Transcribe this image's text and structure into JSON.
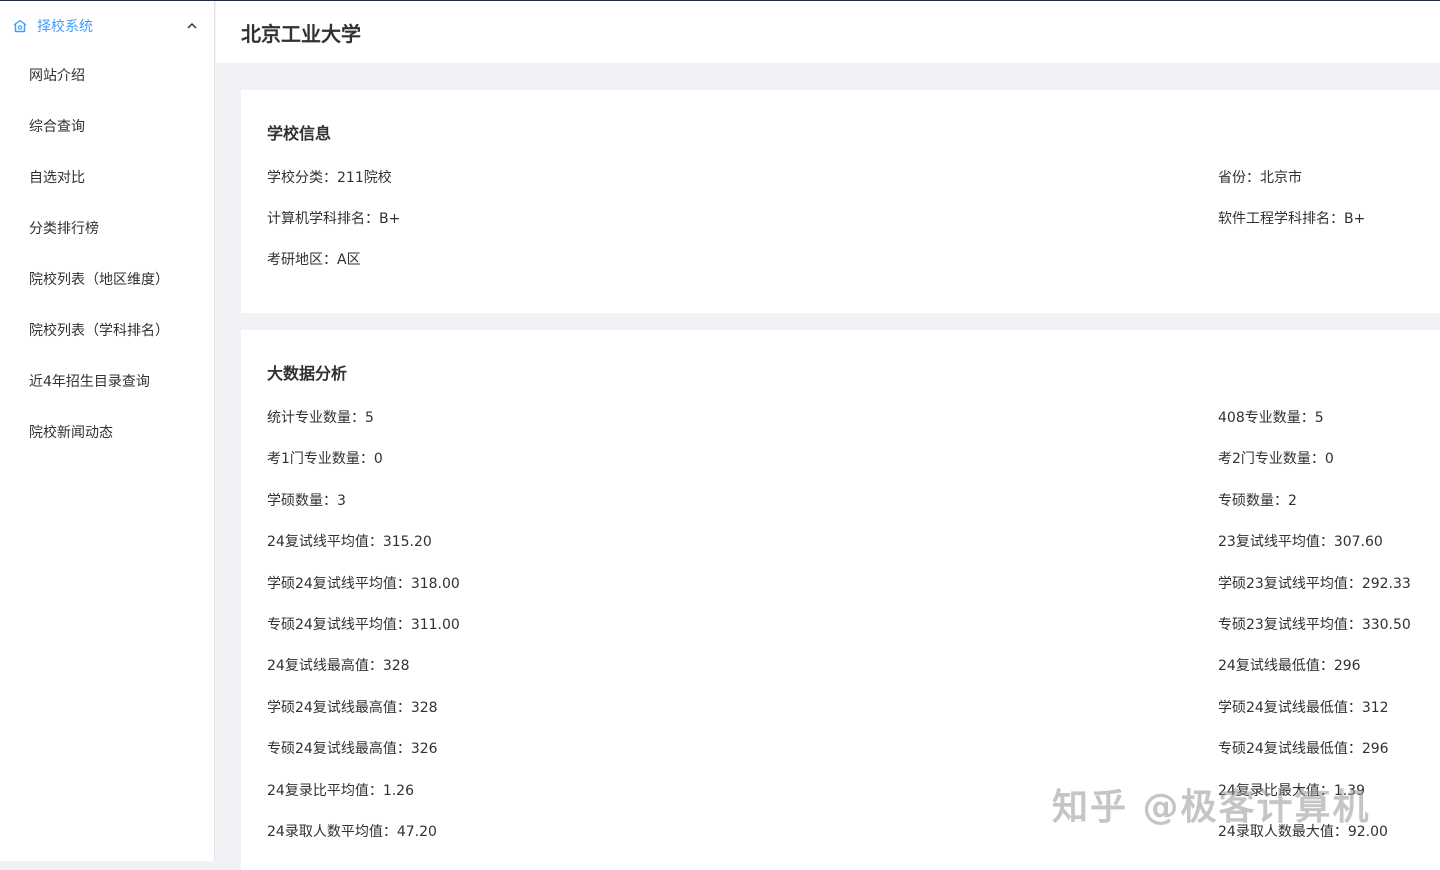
{
  "sidebar": {
    "menu_title": "择校系统",
    "items": [
      {
        "label": "网站介绍"
      },
      {
        "label": "综合查询"
      },
      {
        "label": "自选对比"
      },
      {
        "label": "分类排行榜"
      },
      {
        "label": "院校列表（地区维度）"
      },
      {
        "label": "院校列表（学科排名）"
      },
      {
        "label": "近4年招生目录查询"
      },
      {
        "label": "院校新闻动态"
      }
    ]
  },
  "header": {
    "title": "北京工业大学"
  },
  "school_info": {
    "heading": "学校信息",
    "rows": [
      {
        "left": "学校分类：211院校",
        "right": "省份：北京市"
      },
      {
        "left": "计算机学科排名：B+",
        "right": "软件工程学科排名：B+"
      },
      {
        "left": "考研地区：A区",
        "right": ""
      }
    ]
  },
  "analysis": {
    "heading": "大数据分析",
    "rows": [
      {
        "left": "统计专业数量：5",
        "right": "408专业数量：5"
      },
      {
        "left": "考1门专业数量：0",
        "right": "考2门专业数量：0"
      },
      {
        "left": "学硕数量：3",
        "right": "专硕数量：2"
      },
      {
        "left": "24复试线平均值：315.20",
        "right": "23复试线平均值：307.60"
      },
      {
        "left": "学硕24复试线平均值：318.00",
        "right": "学硕23复试线平均值：292.33"
      },
      {
        "left": "专硕24复试线平均值：311.00",
        "right": "专硕23复试线平均值：330.50"
      },
      {
        "left": "24复试线最高值：328",
        "right": "24复试线最低值：296"
      },
      {
        "left": "学硕24复试线最高值：328",
        "right": "学硕24复试线最低值：312"
      },
      {
        "left": "专硕24复试线最高值：326",
        "right": "专硕24复试线最低值：296"
      },
      {
        "left": "24复录比平均值：1.26",
        "right": "24复录比最大值：1.39"
      },
      {
        "left": "24录取人数平均值：47.20",
        "right": "24录取人数最大值：92.00"
      }
    ]
  },
  "watermark": "知乎 @极客计算机"
}
